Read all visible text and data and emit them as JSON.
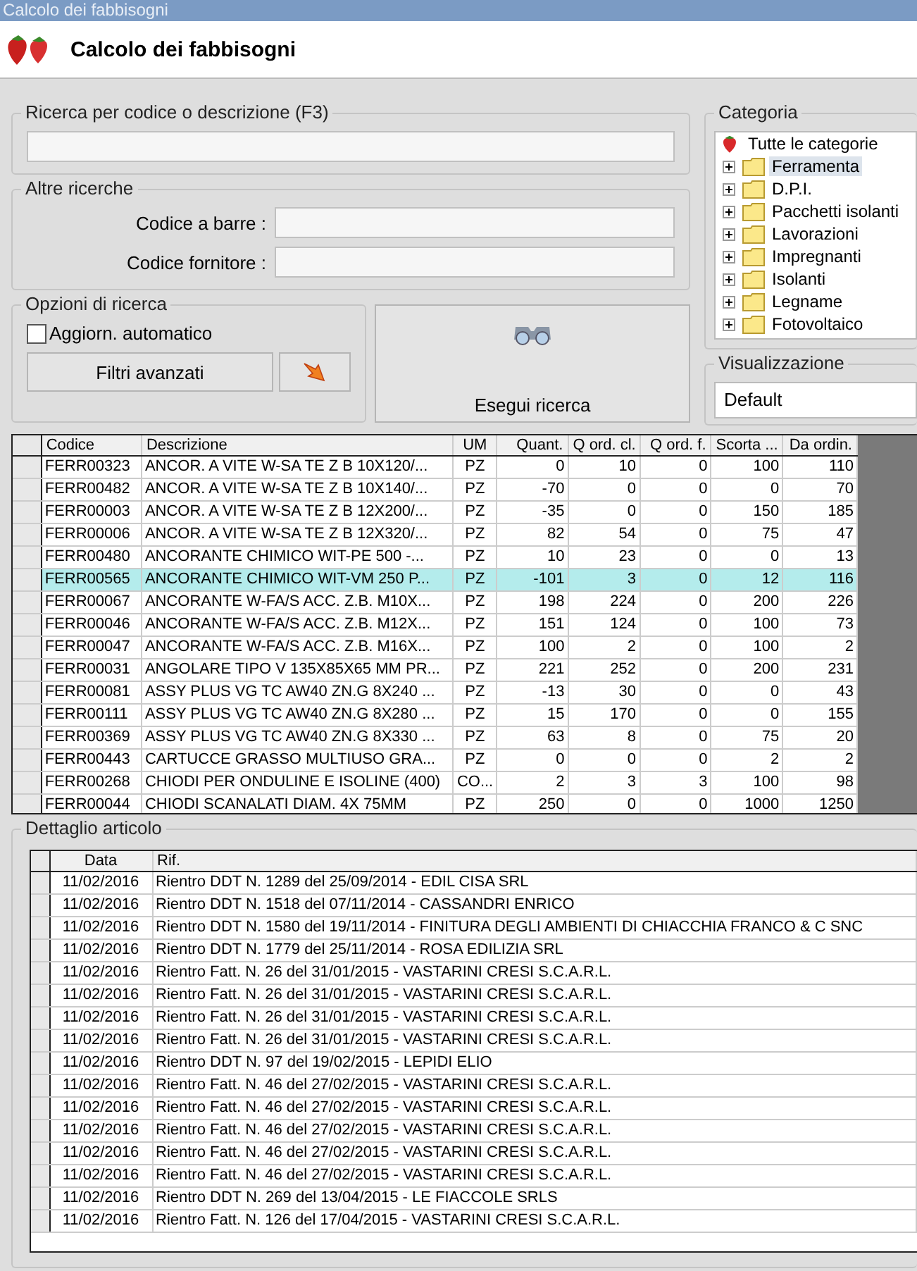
{
  "window": {
    "title": "Calcolo dei fabbisogni"
  },
  "header": {
    "title": "Calcolo dei fabbisogni"
  },
  "search_group": {
    "legend": "Ricerca per codice o descrizione (F3)"
  },
  "other_searches": {
    "legend": "Altre ricerche",
    "fields": [
      {
        "label": "Codice a barre :"
      },
      {
        "label": "Codice fornitore :"
      }
    ]
  },
  "search_options": {
    "legend": "Opzioni di ricerca",
    "checkbox": {
      "label": "Aggiorn. automatico",
      "checked": false
    },
    "filter_button": "Filtri avanzati"
  },
  "run_search_button": "Esegui ricerca",
  "category": {
    "legend": "Categoria",
    "root": "Tutte le categorie",
    "items": [
      {
        "label": "Ferramenta",
        "selected": true,
        "expanded": false
      },
      {
        "label": "D.P.I.",
        "selected": false,
        "expanded": false
      },
      {
        "label": "Pacchetti isolanti",
        "selected": false,
        "expanded": false
      },
      {
        "label": "Lavorazioni",
        "selected": false,
        "expanded": false
      },
      {
        "label": "Impregnanti",
        "selected": false,
        "expanded": false
      },
      {
        "label": "Isolanti",
        "selected": false,
        "expanded": false
      },
      {
        "label": "Legname",
        "selected": false,
        "expanded": false
      },
      {
        "label": "Fotovoltaico",
        "selected": false,
        "expanded": false
      }
    ]
  },
  "view": {
    "legend": "Visualizzazione",
    "value": "Default"
  },
  "grid": {
    "columns": [
      "Codice",
      "Descrizione",
      "UM",
      "Quant.",
      "Q ord. cl.",
      "Q ord. f.",
      "Scorta ...",
      "Da ordin."
    ],
    "rows": [
      {
        "selected": false,
        "cells": [
          "FERR00323",
          "ANCOR. A VITE W-SA TE Z B 10X120/...",
          "PZ",
          "0",
          "10",
          "0",
          "100",
          "110"
        ]
      },
      {
        "selected": false,
        "cells": [
          "FERR00482",
          "ANCOR. A VITE W-SA TE Z B 10X140/...",
          "PZ",
          "-70",
          "0",
          "0",
          "0",
          "70"
        ]
      },
      {
        "selected": false,
        "cells": [
          "FERR00003",
          "ANCOR. A VITE W-SA TE Z B 12X200/...",
          "PZ",
          "-35",
          "0",
          "0",
          "150",
          "185"
        ]
      },
      {
        "selected": false,
        "cells": [
          "FERR00006",
          "ANCOR. A VITE W-SA TE Z B 12X320/...",
          "PZ",
          "82",
          "54",
          "0",
          "75",
          "47"
        ]
      },
      {
        "selected": false,
        "cells": [
          "FERR00480",
          "ANCORANTE CHIMICO WIT-PE 500 -...",
          "PZ",
          "10",
          "23",
          "0",
          "0",
          "13"
        ]
      },
      {
        "selected": true,
        "cells": [
          "FERR00565",
          "ANCORANTE CHIMICO WIT-VM 250 P...",
          "PZ",
          "-101",
          "3",
          "0",
          "12",
          "116"
        ]
      },
      {
        "selected": false,
        "cells": [
          "FERR00067",
          "ANCORANTE W-FA/S ACC. Z.B. M10X...",
          "PZ",
          "198",
          "224",
          "0",
          "200",
          "226"
        ]
      },
      {
        "selected": false,
        "cells": [
          "FERR00046",
          "ANCORANTE W-FA/S ACC. Z.B. M12X...",
          "PZ",
          "151",
          "124",
          "0",
          "100",
          "73"
        ]
      },
      {
        "selected": false,
        "cells": [
          "FERR00047",
          "ANCORANTE W-FA/S ACC. Z.B. M16X...",
          "PZ",
          "100",
          "2",
          "0",
          "100",
          "2"
        ]
      },
      {
        "selected": false,
        "cells": [
          "FERR00031",
          "ANGOLARE TIPO V 135X85X65 MM PR...",
          "PZ",
          "221",
          "252",
          "0",
          "200",
          "231"
        ]
      },
      {
        "selected": false,
        "cells": [
          "FERR00081",
          "ASSY PLUS VG TC AW40 ZN.G 8X240 ...",
          "PZ",
          "-13",
          "30",
          "0",
          "0",
          "43"
        ]
      },
      {
        "selected": false,
        "cells": [
          "FERR00111",
          "ASSY PLUS VG TC AW40 ZN.G 8X280 ...",
          "PZ",
          "15",
          "170",
          "0",
          "0",
          "155"
        ]
      },
      {
        "selected": false,
        "cells": [
          "FERR00369",
          "ASSY PLUS VG TC AW40 ZN.G 8X330 ...",
          "PZ",
          "63",
          "8",
          "0",
          "75",
          "20"
        ]
      },
      {
        "selected": false,
        "cells": [
          "FERR00443",
          "CARTUCCE GRASSO MULTIUSO  GRA...",
          "PZ",
          "0",
          "0",
          "0",
          "2",
          "2"
        ]
      },
      {
        "selected": false,
        "cells": [
          "FERR00268",
          "CHIODI PER ONDULINE E ISOLINE (400)",
          "CO...",
          "2",
          "3",
          "3",
          "100",
          "98"
        ]
      },
      {
        "selected": false,
        "cells": [
          "FERR00044",
          "CHIODI SCANALATI DIAM. 4X 75MM",
          "PZ",
          "250",
          "0",
          "0",
          "1000",
          "1250"
        ]
      }
    ]
  },
  "detail": {
    "legend": "Dettaglio articolo",
    "columns": [
      "Data",
      "Rif."
    ],
    "rows": [
      [
        "11/02/2016",
        "Rientro DDT N. 1289 del 25/09/2014 - EDIL CISA SRL"
      ],
      [
        "11/02/2016",
        "Rientro DDT N. 1518 del 07/11/2014 - CASSANDRI ENRICO"
      ],
      [
        "11/02/2016",
        "Rientro DDT N. 1580 del 19/11/2014 - FINITURA DEGLI AMBIENTI DI CHIACCHIA FRANCO & C SNC"
      ],
      [
        "11/02/2016",
        "Rientro DDT N. 1779 del 25/11/2014 - ROSA EDILIZIA SRL"
      ],
      [
        "11/02/2016",
        "Rientro Fatt. N. 26 del 31/01/2015 - VASTARINI CRESI S.C.A.R.L."
      ],
      [
        "11/02/2016",
        "Rientro Fatt. N. 26 del 31/01/2015 - VASTARINI CRESI S.C.A.R.L."
      ],
      [
        "11/02/2016",
        "Rientro Fatt. N. 26 del 31/01/2015 - VASTARINI CRESI S.C.A.R.L."
      ],
      [
        "11/02/2016",
        "Rientro Fatt. N. 26 del 31/01/2015 - VASTARINI CRESI S.C.A.R.L."
      ],
      [
        "11/02/2016",
        "Rientro DDT N. 97 del 19/02/2015 - LEPIDI ELIO"
      ],
      [
        "11/02/2016",
        "Rientro Fatt. N. 46 del 27/02/2015 - VASTARINI CRESI S.C.A.R.L."
      ],
      [
        "11/02/2016",
        "Rientro Fatt. N. 46 del 27/02/2015 - VASTARINI CRESI S.C.A.R.L."
      ],
      [
        "11/02/2016",
        "Rientro Fatt. N. 46 del 27/02/2015 - VASTARINI CRESI S.C.A.R.L."
      ],
      [
        "11/02/2016",
        "Rientro Fatt. N. 46 del 27/02/2015 - VASTARINI CRESI S.C.A.R.L."
      ],
      [
        "11/02/2016",
        "Rientro Fatt. N. 46 del 27/02/2015 - VASTARINI CRESI S.C.A.R.L."
      ],
      [
        "11/02/2016",
        "Rientro DDT N. 269 del 13/04/2015 - LE FIACCOLE SRLS"
      ],
      [
        "11/02/2016",
        "Rientro Fatt. N. 126 del 17/04/2015 - VASTARINI CRESI S.C.A.R.L."
      ]
    ]
  }
}
